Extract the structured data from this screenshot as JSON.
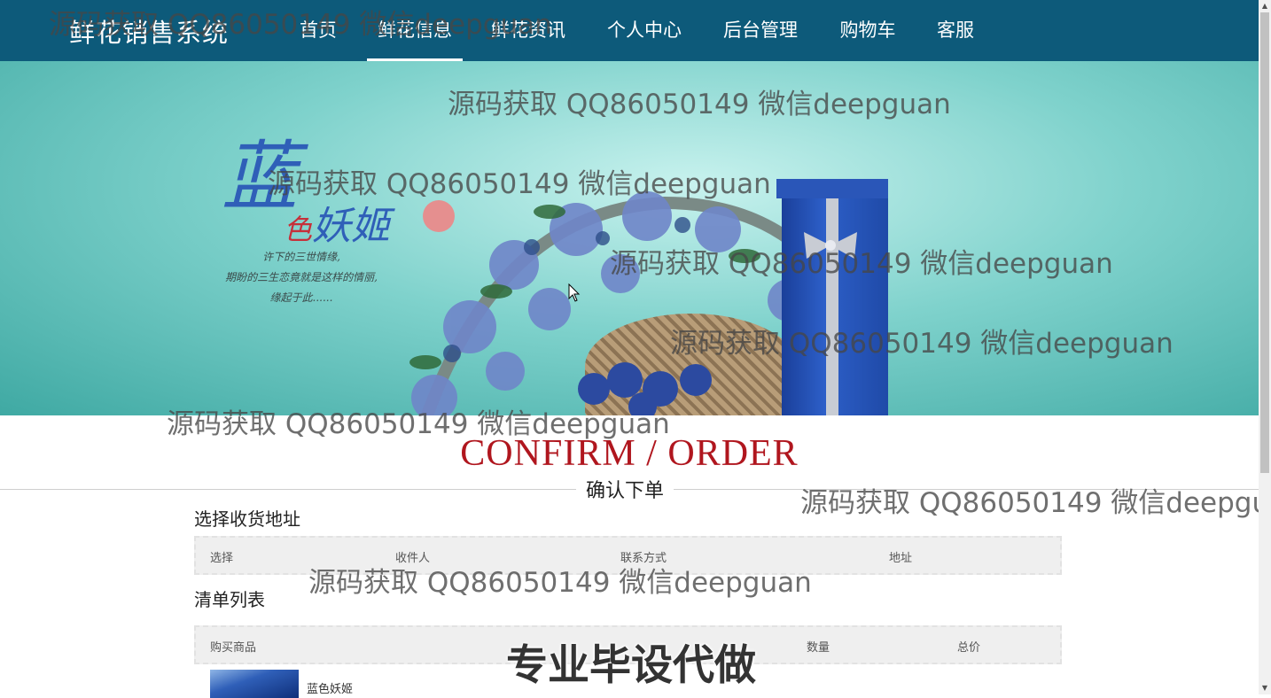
{
  "app": {
    "brand": "鲜花销售系统"
  },
  "nav": {
    "items": [
      {
        "label": "首页",
        "active": false
      },
      {
        "label": "鲜花信息",
        "active": true
      },
      {
        "label": "鲜花资讯",
        "active": false
      },
      {
        "label": "个人中心",
        "active": false
      },
      {
        "label": "后台管理",
        "active": false
      },
      {
        "label": "购物车",
        "active": false
      },
      {
        "label": "客服",
        "active": false
      }
    ]
  },
  "banner": {
    "title_big": "蓝",
    "title_small_red": "色",
    "title_rest": "妖姬",
    "poem": [
      "许下的三世情缘,",
      "期盼的三生恋竟就是这样的情丽,",
      "缘起于此......"
    ]
  },
  "page": {
    "heading": "CONFIRM / ORDER",
    "subheading": "确认下单"
  },
  "address_section": {
    "title": "选择收货地址",
    "columns": [
      "选择",
      "收件人",
      "联系方式",
      "地址"
    ]
  },
  "order_section": {
    "title": "清单列表",
    "columns": [
      "购买商品",
      "数量",
      "总价"
    ],
    "items": [
      {
        "name": "蓝色妖姬"
      }
    ]
  },
  "watermark_text": "源码获取 QQ86050149 微信deepguan",
  "stamp_text": "专业毕设代做",
  "colors": {
    "nav_bg": "#0d5a7a",
    "heading_red": "#b0161e",
    "banner_teal": "#7fd2cc"
  }
}
